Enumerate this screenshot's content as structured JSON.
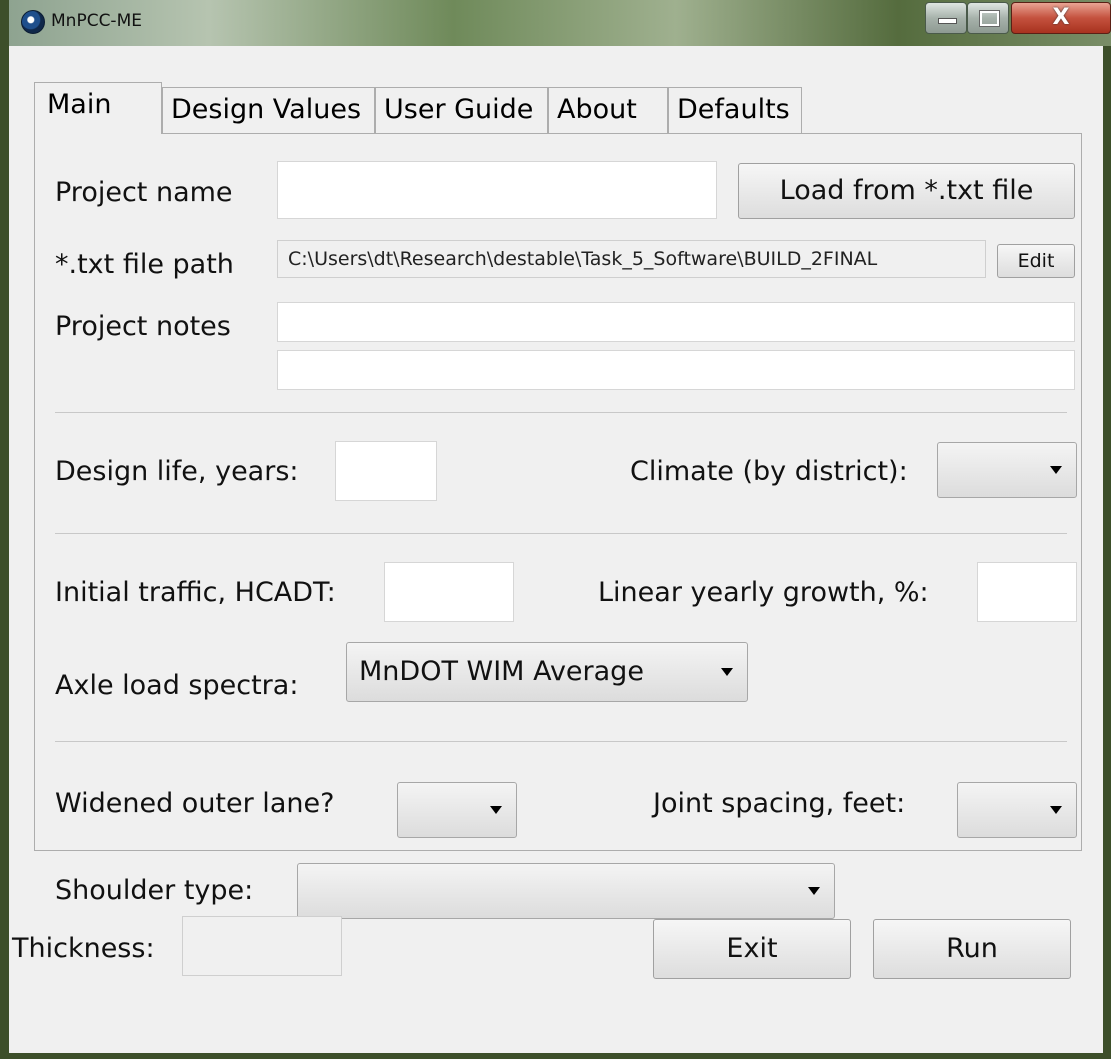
{
  "window": {
    "title": "MnPCC-ME"
  },
  "tabs": [
    {
      "label": "Main"
    },
    {
      "label": "Design Values"
    },
    {
      "label": "User Guide"
    },
    {
      "label": "About"
    },
    {
      "label": "Defaults"
    }
  ],
  "main": {
    "project_name_label": "Project name",
    "project_name_value": "",
    "load_button": "Load from *.txt file",
    "path_label": "*.txt file path",
    "path_value": "C:\\Users\\dt\\Research\\destable\\Task_5_Software\\BUILD_2FINAL",
    "edit_button": "Edit",
    "notes_label": "Project notes",
    "notes_line1": "",
    "notes_line2": "",
    "design_life_label": "Design life, years:",
    "design_life_value": "",
    "climate_label": "Climate (by district):",
    "climate_value": "",
    "initial_traffic_label": "Initial traffic, HCADT:",
    "initial_traffic_value": "",
    "growth_label": "Linear yearly growth, %:",
    "growth_value": "",
    "axle_label": "Axle load spectra:",
    "axle_value": "MnDOT WIM Average",
    "widened_label": "Widened outer lane?",
    "widened_value": "",
    "joint_label": "Joint spacing, feet:",
    "joint_value": "",
    "shoulder_label": "Shoulder type:",
    "shoulder_value": ""
  },
  "footer": {
    "thickness_label": "Thickness:",
    "thickness_value": "",
    "exit_button": "Exit",
    "run_button": "Run"
  }
}
